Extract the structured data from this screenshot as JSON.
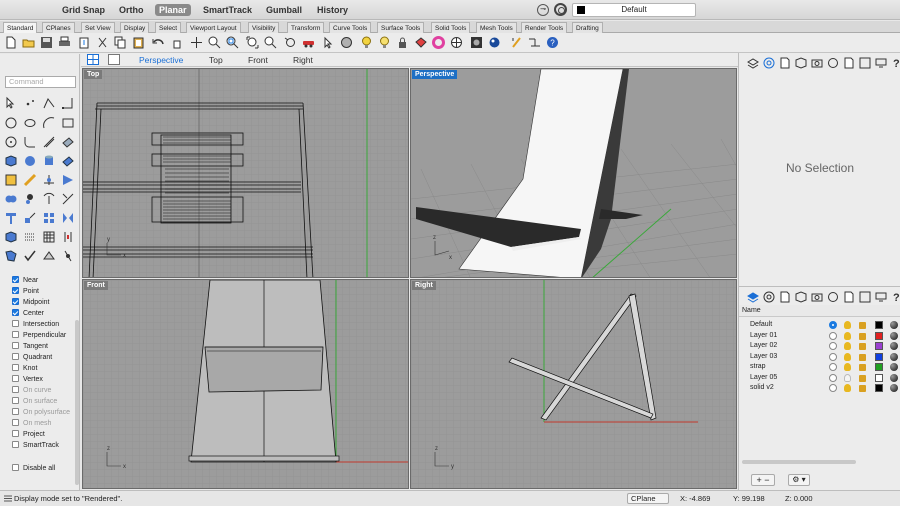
{
  "titlebar": {
    "modes": [
      "Grid Snap",
      "Ortho",
      "Planar",
      "SmartTrack",
      "Gumball",
      "History"
    ],
    "active_mode": "Planar",
    "layer_select": "Default"
  },
  "tabs": [
    "Standard",
    "CPlanes",
    "Set View",
    "Display",
    "Select",
    "Viewport Layout",
    "Visibility",
    "Transform",
    "Curve Tools",
    "Surface Tools",
    "Solid Tools",
    "Mesh Tools",
    "Render Tools",
    "Drafting"
  ],
  "active_tab": "Standard",
  "command": {
    "placeholder": "Command"
  },
  "viewport_tabs": [
    "Perspective",
    "Top",
    "Front",
    "Right"
  ],
  "active_viewport_tab": "Perspective",
  "viewports": {
    "top": "Top",
    "perspective": "Perspective",
    "front": "Front",
    "right": "Right"
  },
  "snaps": [
    {
      "label": "Near",
      "checked": true,
      "enabled": true
    },
    {
      "label": "Point",
      "checked": true,
      "enabled": true
    },
    {
      "label": "Midpoint",
      "checked": true,
      "enabled": true
    },
    {
      "label": "Center",
      "checked": true,
      "enabled": true
    },
    {
      "label": "Intersection",
      "checked": false,
      "enabled": true
    },
    {
      "label": "Perpendicular",
      "checked": false,
      "enabled": true
    },
    {
      "label": "Tangent",
      "checked": false,
      "enabled": true
    },
    {
      "label": "Quadrant",
      "checked": false,
      "enabled": true
    },
    {
      "label": "Knot",
      "checked": false,
      "enabled": true
    },
    {
      "label": "Vertex",
      "checked": false,
      "enabled": true
    },
    {
      "label": "On curve",
      "checked": false,
      "enabled": false
    },
    {
      "label": "On surface",
      "checked": false,
      "enabled": false
    },
    {
      "label": "On polysurface",
      "checked": false,
      "enabled": false
    },
    {
      "label": "On mesh",
      "checked": false,
      "enabled": false
    },
    {
      "label": "Project",
      "checked": false,
      "enabled": true
    },
    {
      "label": "SmartTrack",
      "checked": false,
      "enabled": true
    }
  ],
  "disable_all": "Disable all",
  "properties": {
    "empty_text": "No Selection"
  },
  "layers": {
    "header": "Name",
    "rows": [
      {
        "name": "Default",
        "current": true,
        "color": "#000000"
      },
      {
        "name": "Layer 01",
        "current": false,
        "color": "#e02020"
      },
      {
        "name": "Layer 02",
        "current": false,
        "color": "#9a40d0"
      },
      {
        "name": "Layer 03",
        "current": false,
        "color": "#1040e0"
      },
      {
        "name": "strap",
        "current": false,
        "color": "#20a020"
      },
      {
        "name": "Layer 05",
        "current": false,
        "color": "#ffffff"
      },
      {
        "name": "solid v2",
        "current": false,
        "color": "#000000"
      }
    ],
    "add_label": "+ −",
    "gear_label": "⚙ ▾"
  },
  "status": {
    "message": "Display mode set to \"Rendered\".",
    "cplane": "CPlane",
    "x": "X: -4.869",
    "y": "Y: 99.198",
    "z": "Z: 0.000"
  }
}
